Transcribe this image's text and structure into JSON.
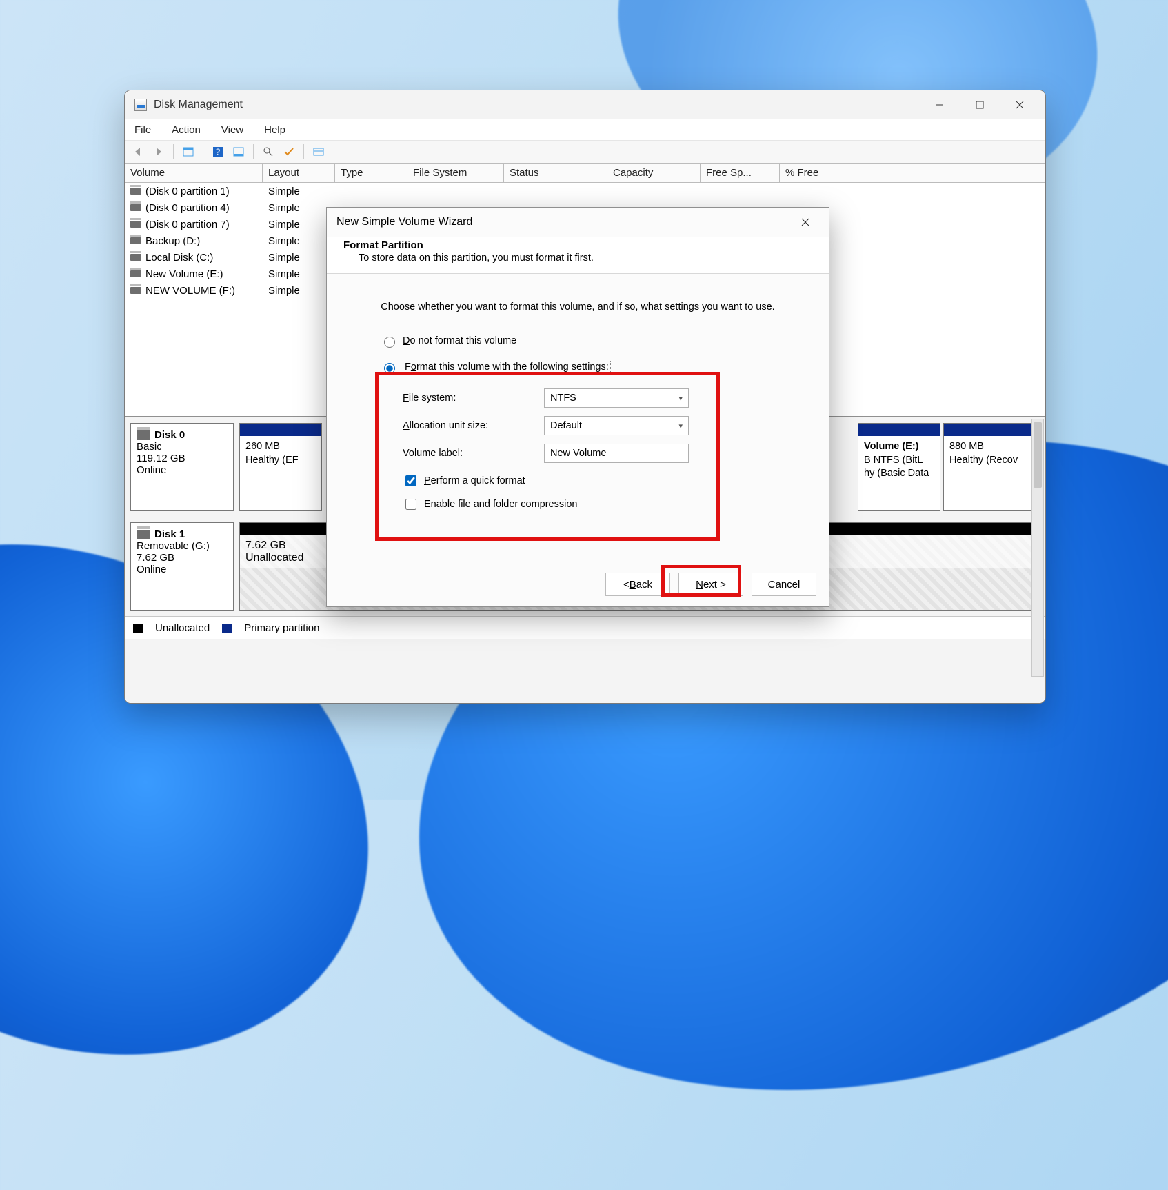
{
  "window": {
    "title": "Disk Management",
    "menus": [
      "File",
      "Action",
      "View",
      "Help"
    ]
  },
  "columns": {
    "volume": "Volume",
    "layout": "Layout",
    "type": "Type",
    "fs": "File System",
    "status": "Status",
    "capacity": "Capacity",
    "free": "Free Sp...",
    "pct": "% Free"
  },
  "volumes": [
    {
      "name": "(Disk 0 partition 1)",
      "layout": "Simple"
    },
    {
      "name": "(Disk 0 partition 4)",
      "layout": "Simple"
    },
    {
      "name": "(Disk 0 partition 7)",
      "layout": "Simple"
    },
    {
      "name": "Backup (D:)",
      "layout": "Simple"
    },
    {
      "name": "Local Disk (C:)",
      "layout": "Simple"
    },
    {
      "name": "New Volume (E:)",
      "layout": "Simple"
    },
    {
      "name": "NEW VOLUME (F:)",
      "layout": "Simple"
    }
  ],
  "disk0": {
    "name": "Disk 0",
    "type": "Basic",
    "size": "119.12 GB",
    "status": "Online",
    "p1_size": "260 MB",
    "p1_stat": "Healthy (EF",
    "pE_title": "Volume  (E:)",
    "pE_line": "B NTFS (BitL",
    "pE_stat": "hy (Basic Data",
    "pR_size": "880 MB",
    "pR_stat": "Healthy (Recov"
  },
  "disk1": {
    "name": "Disk 1",
    "type": "Removable (G:)",
    "size": "7.62 GB",
    "status": "Online",
    "p_size": "7.62 GB",
    "p_stat": "Unallocated"
  },
  "legend": {
    "unalloc": "Unallocated",
    "primary": "Primary partition"
  },
  "wizard": {
    "title": "New Simple Volume Wizard",
    "heading": "Format Partition",
    "sub": "To store data on this partition, you must format it first.",
    "intro": "Choose whether you want to format this volume, and if so, what settings you want to use.",
    "opt_noformat": "Do not format this volume",
    "opt_format": "Format this volume with the following settings:",
    "lbl_fs": "File system:",
    "val_fs": "NTFS",
    "lbl_au": "Allocation unit size:",
    "val_au": "Default",
    "lbl_vl": "Volume label:",
    "val_vl": "New Volume",
    "chk_quick": "Perform a quick format",
    "chk_compress": "Enable file and folder compression",
    "btn_back": "< Back",
    "btn_next": "Next >",
    "btn_cancel": "Cancel"
  }
}
